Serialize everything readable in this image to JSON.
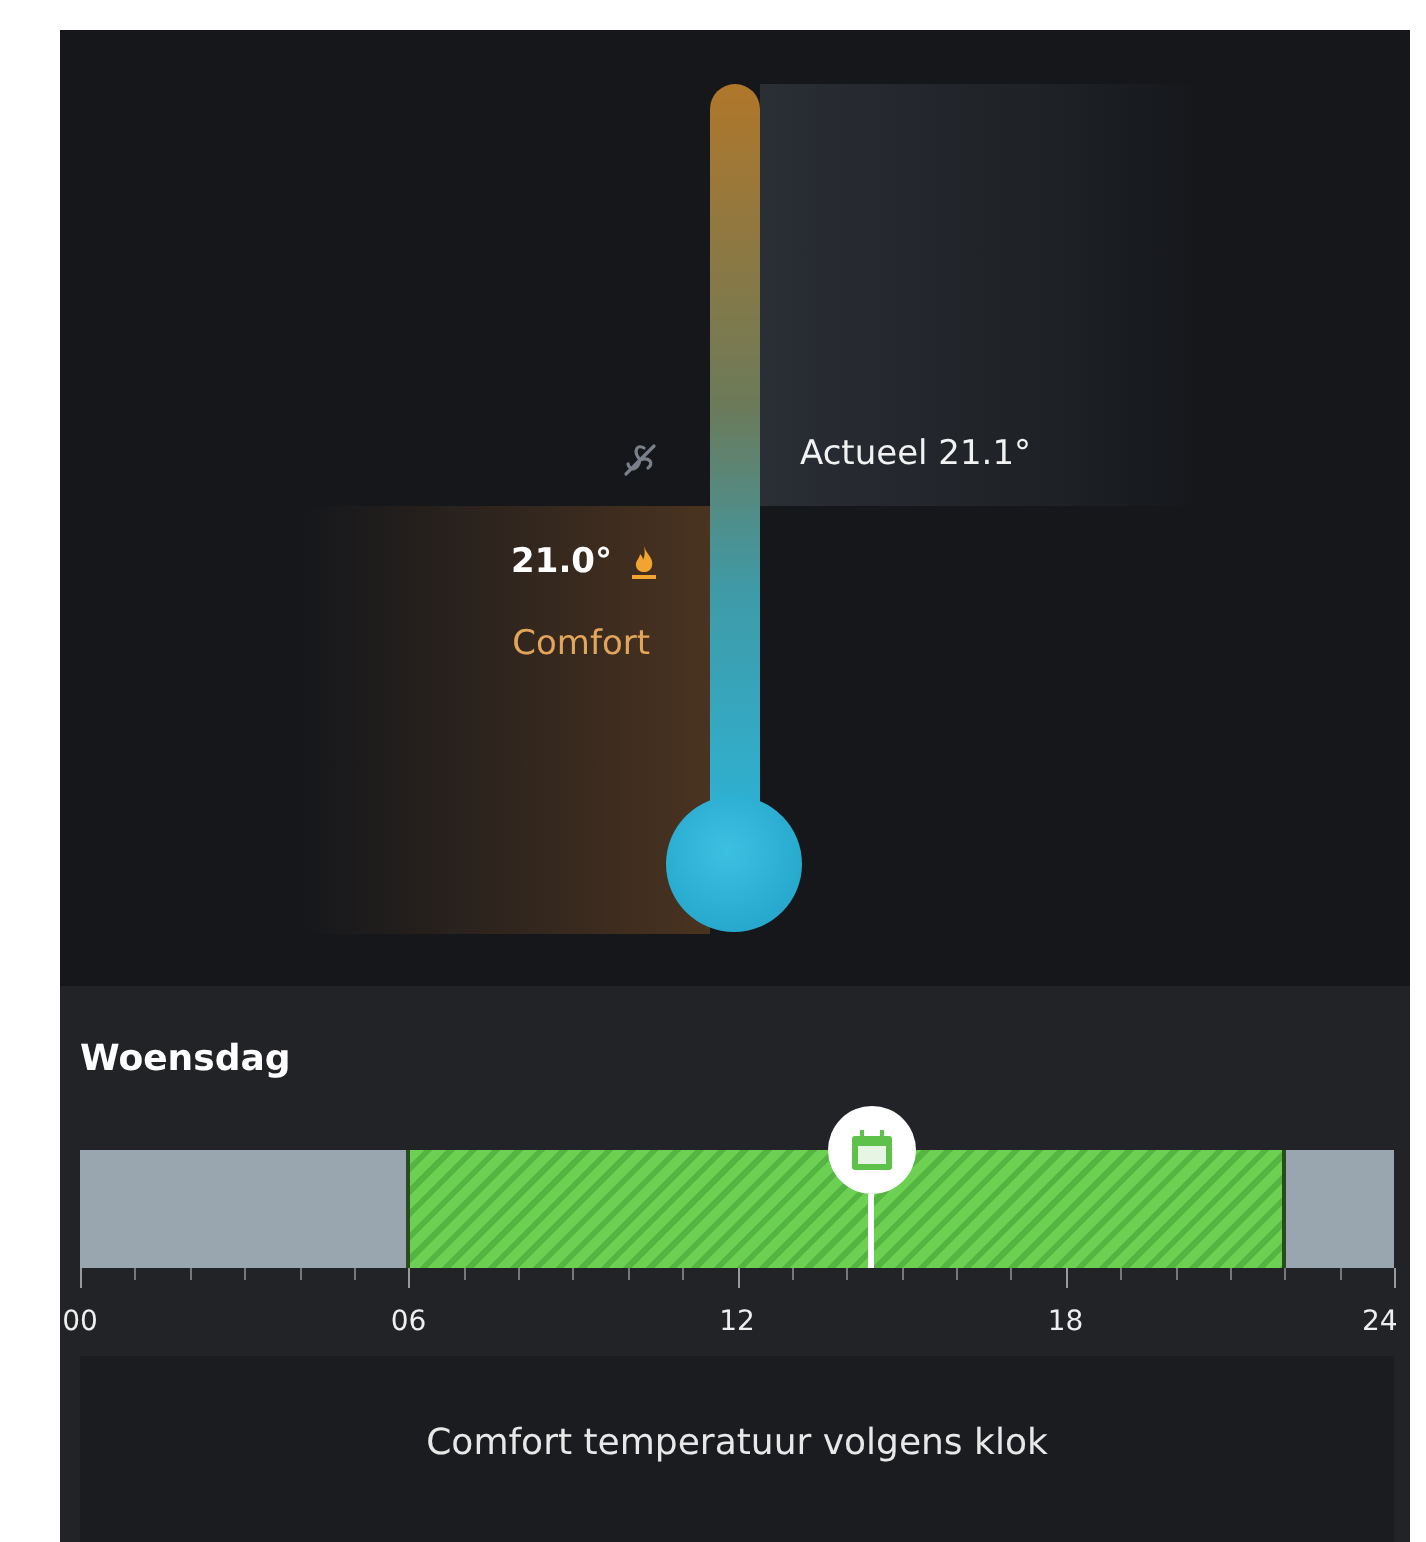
{
  "thermostat": {
    "current": {
      "label": "Actueel 21.1°"
    },
    "setpoint": {
      "value": "21.0°",
      "mode": "Comfort",
      "heating": true
    }
  },
  "schedule": {
    "day": "Woensdag",
    "periods": [
      {
        "kind": "comfort",
        "start": {
          "level": 0.25
        },
        "end": {
          "level": 0.917
        }
      }
    ],
    "now_marker": {
      "level": 0.602
    },
    "axis_labels": [
      "00",
      "06",
      "12",
      "18",
      "24"
    ]
  },
  "status": "Comfort temperatuur volgens klok"
}
